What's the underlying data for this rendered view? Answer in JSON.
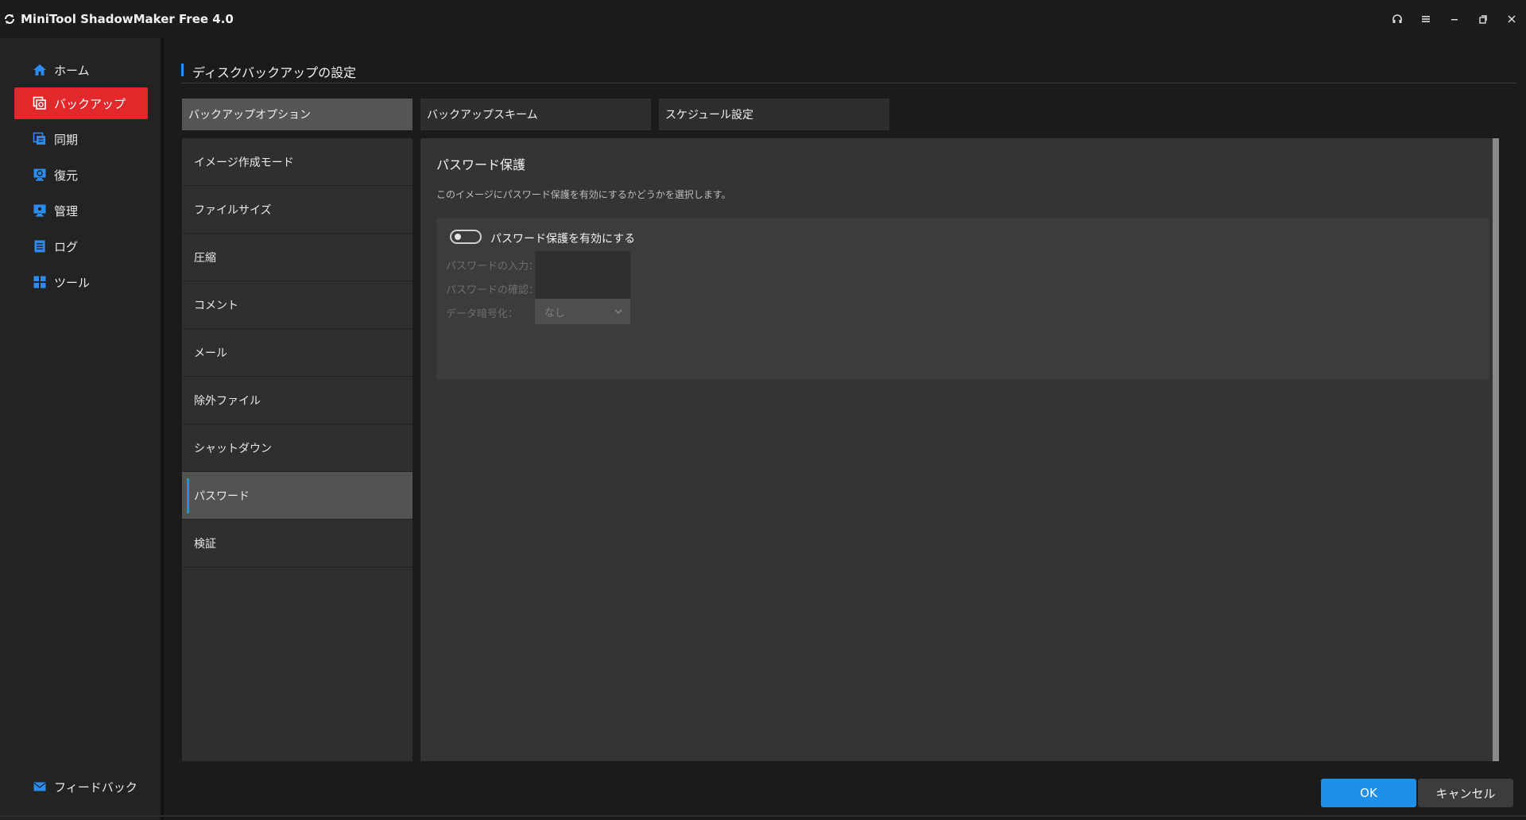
{
  "app": {
    "title": "MiniTool ShadowMaker Free 4.0"
  },
  "colors": {
    "accent": "#2a8cf0",
    "active_nav": "#e3282b",
    "ok_button": "#1e90e8"
  },
  "window_controls": [
    "headset-icon",
    "menu-icon",
    "minimize-icon",
    "restore-icon",
    "close-icon"
  ],
  "sidebar": {
    "items": [
      {
        "label": "ホーム",
        "icon": "home-icon"
      },
      {
        "label": "バックアップ",
        "icon": "backup-icon",
        "active": true
      },
      {
        "label": "同期",
        "icon": "sync-icon"
      },
      {
        "label": "復元",
        "icon": "restore-icon"
      },
      {
        "label": "管理",
        "icon": "manage-icon"
      },
      {
        "label": "ログ",
        "icon": "log-icon"
      },
      {
        "label": "ツール",
        "icon": "tools-icon"
      }
    ],
    "feedback": {
      "label": "フィードバック",
      "icon": "mail-icon"
    }
  },
  "page": {
    "title": "ディスクバックアップの設定"
  },
  "tabs": [
    {
      "label": "バックアップオプション",
      "active": true
    },
    {
      "label": "バックアップスキーム"
    },
    {
      "label": "スケジュール設定"
    }
  ],
  "options": [
    {
      "label": "イメージ作成モード"
    },
    {
      "label": "ファイルサイズ"
    },
    {
      "label": "圧縮"
    },
    {
      "label": "コメント"
    },
    {
      "label": "メール"
    },
    {
      "label": "除外ファイル"
    },
    {
      "label": "シャットダウン"
    },
    {
      "label": "パスワード",
      "active": true
    },
    {
      "label": "検証"
    }
  ],
  "password": {
    "title": "パスワード保護",
    "description": "このイメージにパスワード保護を有効にするかどうかを選択します。",
    "toggle_label": "パスワード保護を有効にする",
    "toggle_on": false,
    "fields": {
      "password_label": "パスワードの入力：",
      "password_value": "",
      "confirm_label": "パスワードの確認：",
      "confirm_value": "",
      "encryption_label": "データ暗号化：",
      "encryption_value": "なし"
    }
  },
  "footer": {
    "ok_label": "OK",
    "cancel_label": "キャンセル"
  }
}
